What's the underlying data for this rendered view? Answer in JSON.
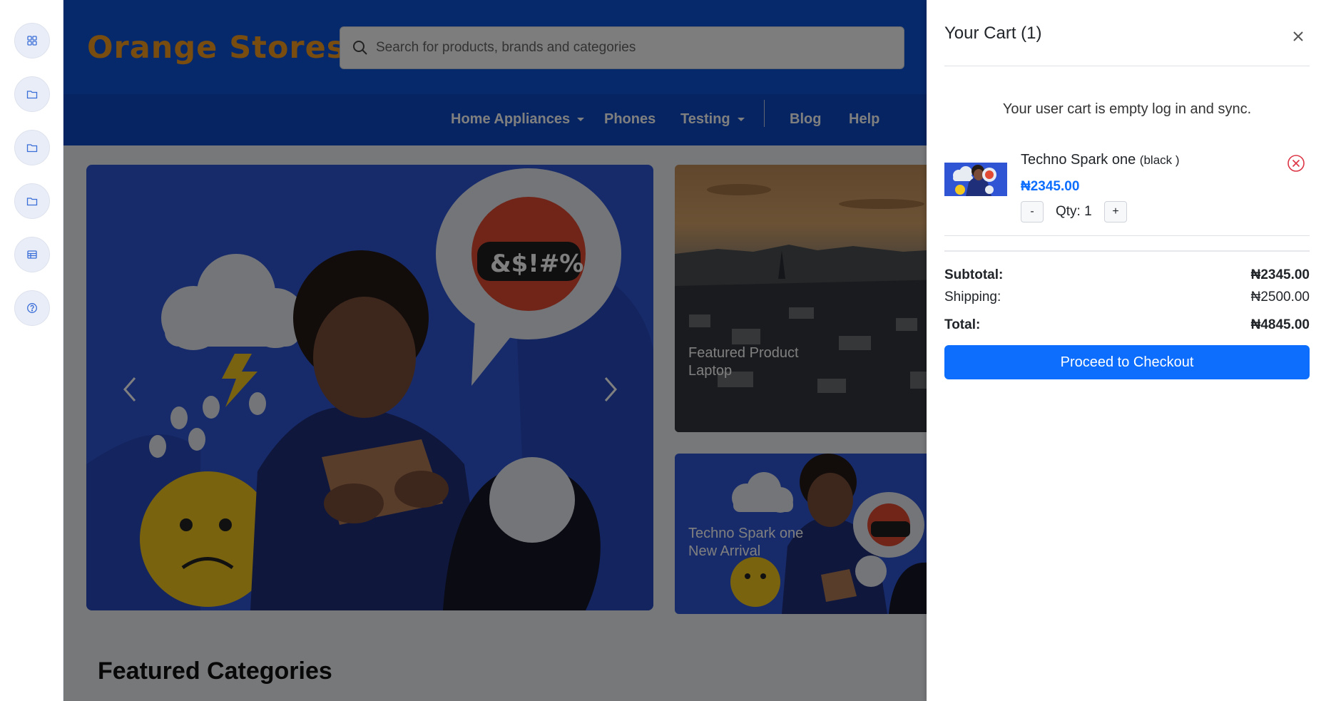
{
  "rail": {
    "items": [
      {
        "icon": "grid-icon"
      },
      {
        "icon": "folder-icon"
      },
      {
        "icon": "folder-icon"
      },
      {
        "icon": "folder-icon"
      },
      {
        "icon": "table-icon"
      },
      {
        "icon": "help-icon"
      }
    ]
  },
  "header": {
    "brand": "Orange Stores",
    "search_placeholder": "Search for products, brands and categories"
  },
  "nav": {
    "items": [
      {
        "label": "Home Appliances"
      },
      {
        "label": "Phones"
      },
      {
        "label": "Testing"
      },
      {
        "label": "Blog"
      },
      {
        "label": "Help"
      }
    ]
  },
  "cards": {
    "card1": {
      "line1": "Featured Product",
      "line2": "Laptop"
    },
    "card2": {
      "line1": "Techno Spark one",
      "line2": "New Arrival"
    }
  },
  "sections": {
    "featured_categories": "Featured Categories"
  },
  "cart": {
    "title": "Your Cart (1)",
    "empty_message": "Your user cart is empty log in and sync.",
    "item": {
      "name": "Techno Spark one",
      "variant": "(black )",
      "price": "₦2345.00",
      "qty_label": "Qty: 1",
      "minus": "-",
      "plus": "+"
    },
    "subtotal_label": "Subtotal:",
    "subtotal_value": "₦2345.00",
    "shipping_label": "Shipping:",
    "shipping_value": "₦2500.00",
    "total_label": "Total:",
    "total_value": "₦4845.00",
    "checkout_label": "Proceed to Checkout"
  },
  "colors": {
    "brand": "#f09a1e",
    "header_blue": "#0d52d6",
    "primary": "#0d6efd",
    "remove_red": "#dc3545"
  }
}
